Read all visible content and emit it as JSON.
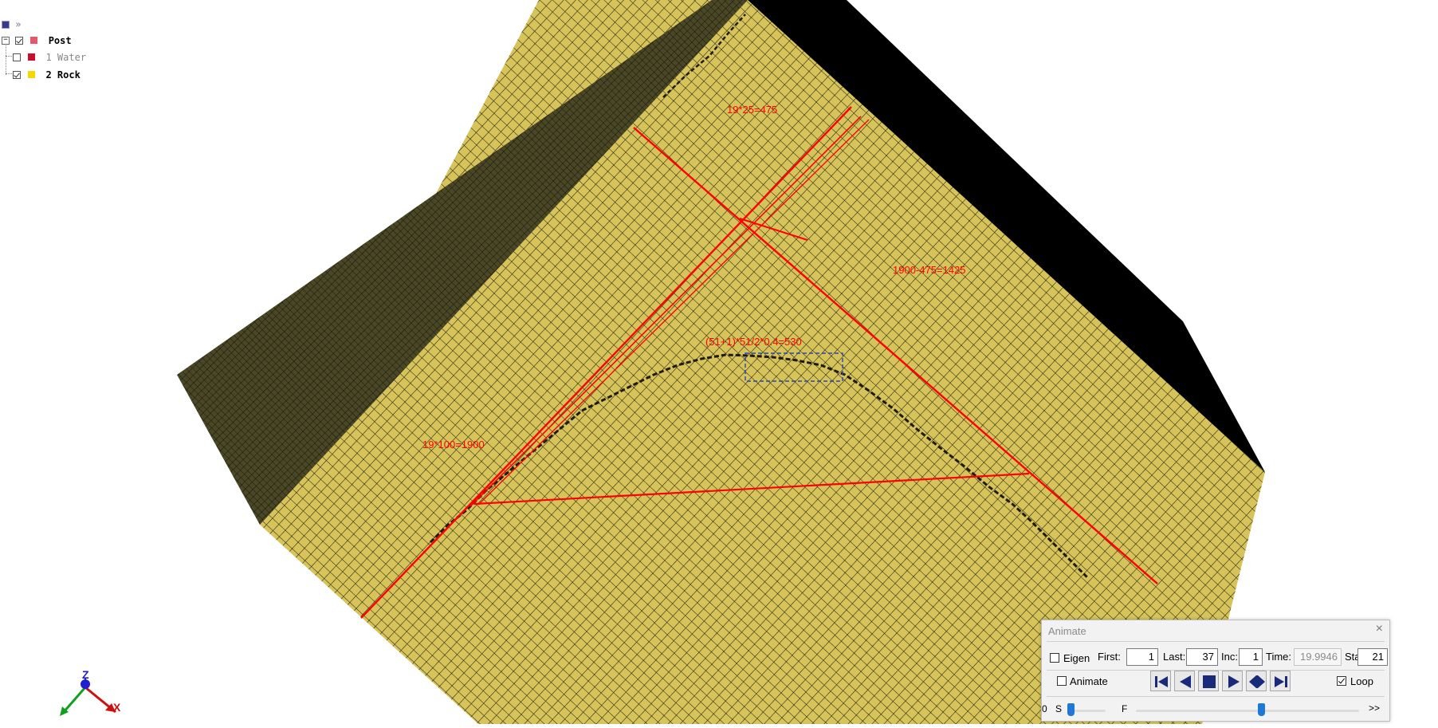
{
  "model_tree": {
    "root": {
      "label": "Post",
      "checked": true,
      "color": "#e05a6a"
    },
    "parts": [
      {
        "label": "1 Water",
        "checked": false,
        "color": "#c8102e"
      },
      {
        "label": "2 Rock",
        "checked": true,
        "color": "#f5d800"
      }
    ]
  },
  "annotations": {
    "top": "19*25=475",
    "right": "1900-475=1425",
    "middle": "(51+1)*51/2*0.4=530",
    "left": "19*100=1900"
  },
  "axis_triad": {
    "z_label": "Z",
    "x_label": "X"
  },
  "colors": {
    "mesh_face": "#d6c45a",
    "mesh_side": "#4a4726",
    "mesh_line": "#1e1b0e",
    "annotation": "#ff0000"
  },
  "animate_panel": {
    "title": "Animate",
    "close_label": "×",
    "eigen_label": "Eigen",
    "eigen_checked": false,
    "first_label": "First:",
    "first_value": "1",
    "last_label": "Last:",
    "last_value": "37",
    "inc_label": "Inc:",
    "inc_value": "1",
    "time_label": "Time:",
    "time_value": "19.9946",
    "state_label": "State:",
    "state_value": "21",
    "animate_label": "Animate",
    "animate_checked": false,
    "loop_label": "Loop",
    "loop_checked": true,
    "slider_min_label": "0",
    "slider_s_label": "S",
    "slider_f_label": "F",
    "slider_more_label": ">>",
    "speed_fraction": 0.0,
    "state_fraction": 0.56
  }
}
